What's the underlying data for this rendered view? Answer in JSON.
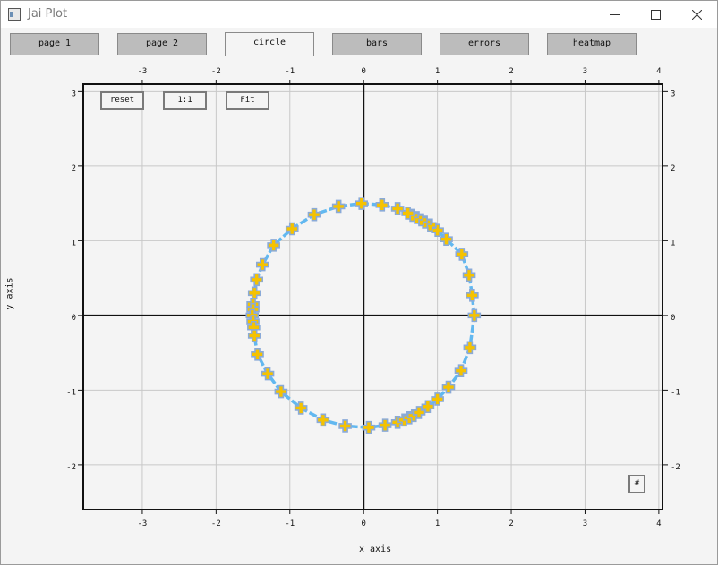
{
  "window": {
    "title": "Jai Plot",
    "controls": [
      "minimize",
      "maximize",
      "close"
    ]
  },
  "tabs": [
    {
      "label": "page 1",
      "active": false
    },
    {
      "label": "page 2",
      "active": false
    },
    {
      "label": "circle",
      "active": true
    },
    {
      "label": "bars",
      "active": false
    },
    {
      "label": "errors",
      "active": false
    },
    {
      "label": "heatmap",
      "active": false
    }
  ],
  "plot_buttons": {
    "reset": "reset",
    "one_to_one": "1:1",
    "fit": "Fit",
    "grid_toggle": "#"
  },
  "colors": {
    "line": "#62b8f0",
    "marker_fill": "#f5c200",
    "marker_border": "#8aaad8",
    "grid": "#c8c8c8",
    "axis": "#111111"
  },
  "chart_data": {
    "type": "scatter",
    "xlabel": "x axis",
    "ylabel": "y axis",
    "xlim": [
      -3.8,
      4.05
    ],
    "ylim": [
      -2.6,
      3.1
    ],
    "x_ticks": [
      -3,
      -2,
      -1,
      0,
      1,
      2,
      3,
      4
    ],
    "y_ticks": [
      -2,
      -1,
      0,
      1,
      2,
      3
    ],
    "grid": true,
    "series": [
      {
        "style": "dashed line with plus markers",
        "radius": 1.5,
        "center": [
          0,
          0
        ],
        "points": [
          [
            1.5,
            0.0
          ],
          [
            1.47,
            0.27
          ],
          [
            1.43,
            0.54
          ],
          [
            1.33,
            0.82
          ],
          [
            1.12,
            1.02
          ],
          [
            1.0,
            1.14
          ],
          [
            0.9,
            1.21
          ],
          [
            0.83,
            1.25
          ],
          [
            0.78,
            1.28
          ],
          [
            0.72,
            1.31
          ],
          [
            0.66,
            1.34
          ],
          [
            0.6,
            1.37
          ],
          [
            0.46,
            1.43
          ],
          [
            0.25,
            1.48
          ],
          [
            -0.03,
            1.5
          ],
          [
            -0.34,
            1.46
          ],
          [
            -0.67,
            1.35
          ],
          [
            -0.97,
            1.16
          ],
          [
            -1.22,
            0.94
          ],
          [
            -1.37,
            0.68
          ],
          [
            -1.45,
            0.48
          ],
          [
            -1.48,
            0.3
          ],
          [
            -1.5,
            0.15
          ],
          [
            -1.5,
            0.08
          ],
          [
            -1.51,
            0.0
          ],
          [
            -1.5,
            -0.08
          ],
          [
            -1.49,
            -0.16
          ],
          [
            -1.48,
            -0.27
          ],
          [
            -1.44,
            -0.52
          ],
          [
            -1.3,
            -0.78
          ],
          [
            -1.12,
            -1.02
          ],
          [
            -0.85,
            -1.24
          ],
          [
            -0.55,
            -1.4
          ],
          [
            -0.25,
            -1.48
          ],
          [
            0.07,
            -1.5
          ],
          [
            0.29,
            -1.47
          ],
          [
            0.46,
            -1.43
          ],
          [
            0.55,
            -1.4
          ],
          [
            0.62,
            -1.37
          ],
          [
            0.68,
            -1.34
          ],
          [
            0.75,
            -1.3
          ],
          [
            0.87,
            -1.22
          ],
          [
            1.0,
            -1.12
          ],
          [
            1.15,
            -0.96
          ],
          [
            1.32,
            -0.74
          ],
          [
            1.44,
            -0.43
          ],
          [
            1.5,
            0.0
          ]
        ]
      }
    ]
  }
}
